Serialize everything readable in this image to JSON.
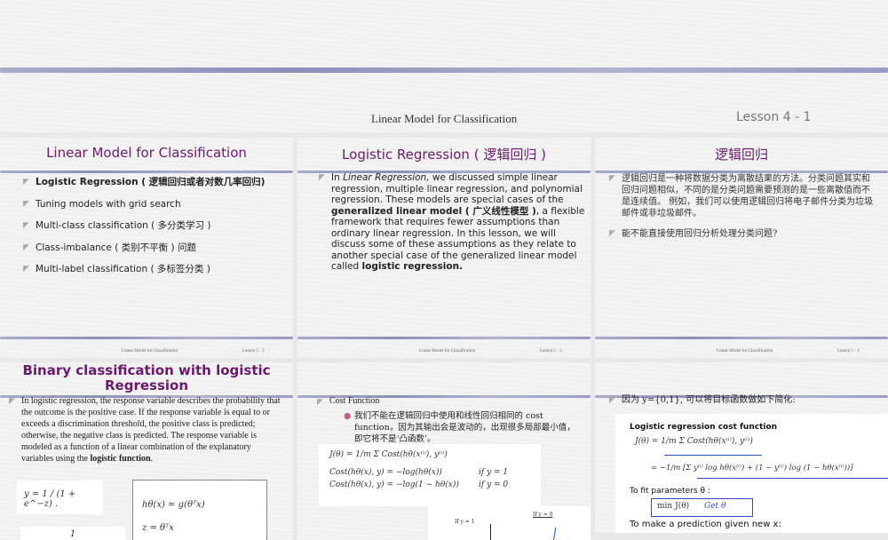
{
  "top_slide": {
    "footer_title": "Linear Model for Classification",
    "footer_lesson": "Lesson 4 - 1"
  },
  "slides": [
    {
      "title": "Linear Model for Classification",
      "items": [
        "Logistic Regression ( 逻辑回归或者对数几率回归)",
        "Tuning models with grid search",
        "Multi-class classification ( 多分类学习 )",
        "Class-imbalance ( 类别不平衡 ) 问题",
        "Multi-label classification ( 多标签分类 )"
      ],
      "footer_title": "Linear Model for Classification",
      "footer_lesson": "Lesson 5 - 2"
    },
    {
      "title": "Logistic Regression ( 逻辑回归 )",
      "p1": "In ",
      "p_italic": "Linear Regression,",
      "p2": " we discussed simple linear regression, multiple linear regression, and polynomial regression. These models are special cases of the ",
      "p_bold1": "generalized linear model ( 广义线性模型 )",
      "p3": ", a flexible framework that requires fewer assumptions than ordinary linear regression. In this lesson, we will discuss some of these assumptions as they relate to another special case of the generalized linear model called ",
      "p_bold2": "logistic regression.",
      "footer_title": "Linear Model for Classification",
      "footer_lesson": "Lesson 5 - 3"
    },
    {
      "title": "逻辑回归",
      "items": [
        "逻辑回归是一种将数据分类为离散结果的方法。分类问题其实和回归问题相似，不同的是分类问题需要预测的是一些离散值而不是连续值。 例如，我们可以使用逻辑回归将电子邮件分类为垃圾邮件或非垃圾邮件。",
        "能不能直接使用回归分析处理分类问题?"
      ],
      "footer_title": "Linear Model for Classification",
      "footer_lesson": "Lesson 5 - 4"
    },
    {
      "title": "Binary classification with logistic Regression",
      "p1": "In logistic regression, the response variable describes the probability that the outcome is the positive case. If the response variable is equal to or exceeds a discrimination threshold, the positive class is predicted; otherwise, the negative class is predicted. The response variable is modeled as a function of a linear combination of the explanatory variables using the ",
      "p_bold": "logistic function",
      "p2": ".",
      "eq1": "y = 1 / (1 + e^−z) .",
      "eq2": "hθ(x) = g(θᵀx)",
      "eq3": "z = θᵀx",
      "eq4": "1"
    },
    {
      "item": "Cost Function",
      "sub": "我们不能在逻辑回归中使用和线性回归相同的 cost function，因为其输出会是波动的，出现很多局部最小值，即它将不是‘凸函数’。",
      "eq1": "J(θ) = 1/m Σ Cost(hθ(x⁽ⁱ⁾), y⁽ⁱ⁾)",
      "eq2": "Cost(hθ(x), y) = −log(hθ(x))",
      "eq2c": "if y = 1",
      "eq3": "Cost(hθ(x), y) = −log(1 − hθ(x))",
      "eq3c": "if y = 0",
      "graph_label1": "If y = 1",
      "graph_label2": "If y = 0"
    },
    {
      "item": "因为 y={0,1}, 可以将目标函数做如下简化:",
      "box_title": "Logistic regression cost function",
      "eq1": "J(θ) = 1/m Σ Cost(hθ(x⁽ⁱ⁾), y⁽ⁱ⁾)",
      "eq2": "= −1/m [Σ y⁽ⁱ⁾ log hθ(x⁽ⁱ⁾) + (1 − y⁽ⁱ⁾) log (1 − hθ(x⁽ⁱ⁾))]",
      "fit": "To fit parameters θ :",
      "min": "min J(θ)",
      "handwritten": "Get θ",
      "predict": "To make a prediction given new x:"
    }
  ]
}
